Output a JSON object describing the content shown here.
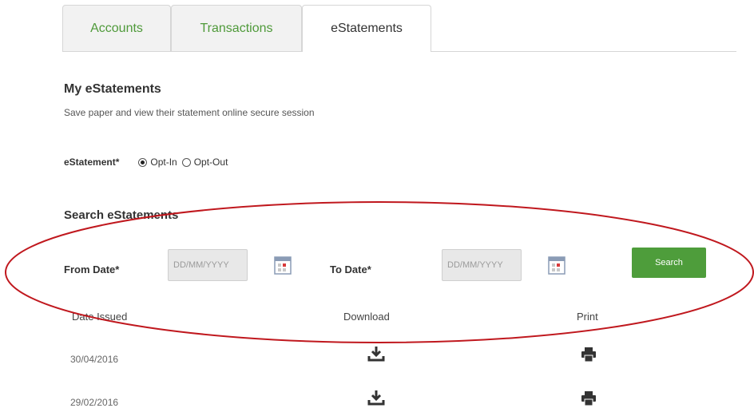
{
  "tabs": [
    {
      "label": "Accounts"
    },
    {
      "label": "Transactions"
    },
    {
      "label": "eStatements"
    }
  ],
  "section": {
    "title": "My eStatements",
    "subtitle": "Save paper and view their statement online secure session"
  },
  "estatement_option": {
    "label": "eStatement*",
    "options": [
      "Opt-In",
      "Opt-Out"
    ],
    "selected": "Opt-In"
  },
  "search": {
    "title": "Search eStatements",
    "from_label": "From Date*",
    "to_label": "To Date*",
    "date_placeholder": "DD/MM/YYYY",
    "button_label": "Search"
  },
  "table": {
    "headers": [
      "Date Issued",
      "Download",
      "Print"
    ],
    "rows": [
      {
        "date": "30/04/2016"
      },
      {
        "date": "29/02/2016"
      }
    ]
  },
  "colors": {
    "accent_green": "#4e9d3b",
    "tab_text_green": "#4f9a3a",
    "annotation_red": "#c0181e"
  },
  "icons": {
    "download": "download-icon",
    "print": "printer-icon",
    "calendar": "calendar-icon"
  }
}
